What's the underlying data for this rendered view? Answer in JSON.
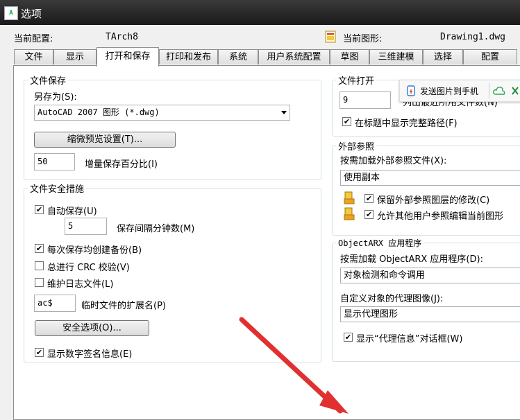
{
  "window": {
    "title": "选项",
    "app_icon": "AutoCAD"
  },
  "config": {
    "current_profile_label": "当前配置:",
    "current_profile_value": "TArch8",
    "current_drawing_label": "当前图形:",
    "current_drawing_value": "Drawing1.dwg"
  },
  "tabs": [
    "文件",
    "显示",
    "打开和保存",
    "打印和发布",
    "系统",
    "用户系统配置",
    "草图",
    "三维建模",
    "选择",
    "配置"
  ],
  "file_save": {
    "title": "文件保存",
    "save_as_label": "另存为(S):",
    "save_as_value": "AutoCAD 2007 图形 (*.dwg)",
    "thumbnail_button": "缩微预览设置(T)...",
    "incremental_value": "50",
    "incremental_label": "增量保存百分比(I)"
  },
  "file_safety": {
    "title": "文件安全措施",
    "autosave_label": "自动保存(U)",
    "autosave_checked": "✔",
    "interval_value": "5",
    "interval_label": "保存间隔分钟数(M)",
    "backup_label": "每次保存均创建备份(B)",
    "backup_checked": "✔",
    "crc_label": "总进行 CRC 校验(V)",
    "log_label": "维护日志文件(L)",
    "temp_ext_value": "ac$",
    "temp_ext_label": "临时文件的扩展名(P)",
    "security_button": "安全选项(O)...",
    "digital_sig_label": "显示数字签名信息(E)",
    "digital_sig_checked": "✔"
  },
  "file_open": {
    "title": "文件打开",
    "recent_value": "9",
    "recent_label": "列出最近所用文件数(N)",
    "fullpath_label": "在标题中显示完整路径(F)",
    "fullpath_checked": "✔"
  },
  "xref": {
    "title": "外部参照",
    "demand_load_label": "按需加载外部参照文件(X):",
    "demand_load_value": "使用副本",
    "retain_label": "保留外部参照图层的修改(C)",
    "retain_checked": "✔",
    "allow_edit_label": "允许其他用户参照编辑当前图形",
    "allow_edit_checked": "✔"
  },
  "objectarx": {
    "title": "ObjectARX 应用程序",
    "demand_label": "按需加载 ObjectARX 应用程序(D):",
    "demand_value": "对象检测和命令调用",
    "proxy_label": "自定义对象的代理图像(J):",
    "proxy_value": "显示代理图形",
    "proxy_info_label": "显示“代理信息”对话框(W)",
    "proxy_info_checked": "✔"
  },
  "floating_toolbar": {
    "send_label": "发送图片到手机"
  }
}
